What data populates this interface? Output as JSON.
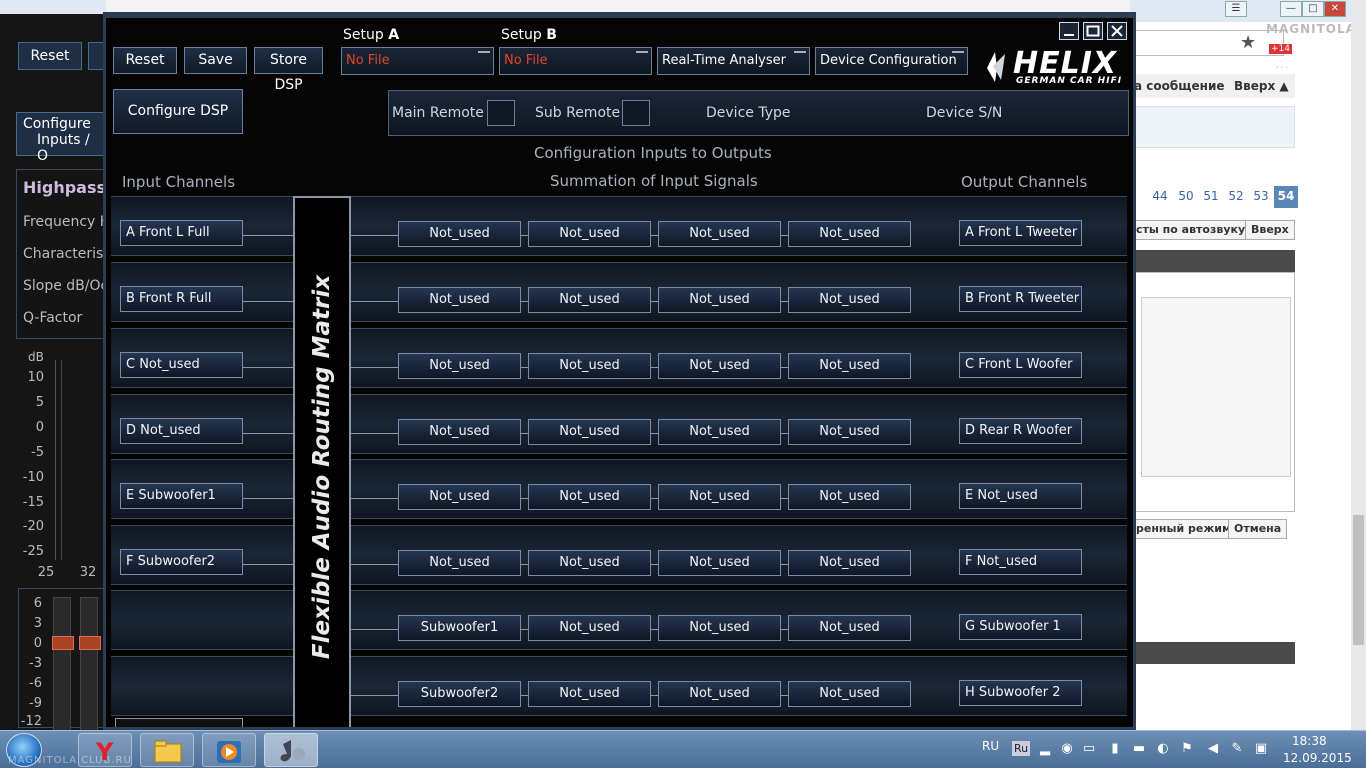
{
  "browser": {
    "pin_buttons": [
      "☰",
      "—",
      "□",
      "✕"
    ],
    "logo": "MAGNITOLA",
    "badge": "+14",
    "faded_heading": "…",
    "bar_left": "а сообщение",
    "bar_right": "Вверх ▲",
    "pages": [
      "44",
      "50",
      "51",
      "52",
      "53",
      "54"
    ],
    "btn_sound": "сты по автозвуку",
    "btn_up": "Вверх",
    "btn_mode": "ренный режим",
    "btn_cancel": "Отмена"
  },
  "left_app": {
    "reset": "Reset",
    "configure_line1": "Configure",
    "configure_line2": "Inputs / O",
    "highpass_title": "Highpass",
    "params": [
      "Frequency H",
      "Characteristi",
      "Slope dB/Oct",
      "Q-Factor"
    ],
    "db": "dB",
    "db_ticks": [
      "10",
      "5",
      "0",
      "-5",
      "-10",
      "-15",
      "-20",
      "-25"
    ],
    "x_ticks": [
      "25",
      "32"
    ],
    "fader_ticks": [
      "6",
      "3",
      "0",
      "-3",
      "-6",
      "-9",
      "-12"
    ]
  },
  "toolbar": {
    "reset": "Reset",
    "save": "Save",
    "store_dsp": "Store DSP",
    "setup_a_prefix": "Setup ",
    "setup_a_letter": "A",
    "setup_b_prefix": "Setup ",
    "setup_b_letter": "B",
    "setup_a_file": "No File",
    "setup_b_file": "No File",
    "rta": "Real-Time Analyser",
    "device_config": "Device Configuration",
    "configure_dsp": "Configure DSP"
  },
  "logo": {
    "brand": "HELIX",
    "sub": "GERMAN CAR HIFI"
  },
  "remote": {
    "main": "Main Remote",
    "sub": "Sub Remote",
    "device_type": "Device Type",
    "device_sn": "Device S/N"
  },
  "headings": {
    "title": "Configuration Inputs to Outputs",
    "inputs": "Input Channels",
    "summation": "Summation of Input Signals",
    "outputs": "Output Channels",
    "vertical": "Flexible Audio Routing Matrix"
  },
  "rows": [
    {
      "input": "A   Front L Full",
      "sums": [
        "Not_used",
        "Not_used",
        "Not_used",
        "Not_used"
      ],
      "output": "A   Front L Tweeter"
    },
    {
      "input": "B   Front R Full",
      "sums": [
        "Not_used",
        "Not_used",
        "Not_used",
        "Not_used"
      ],
      "output": "B   Front R Tweeter"
    },
    {
      "input": "C     Not_used",
      "sums": [
        "Not_used",
        "Not_used",
        "Not_used",
        "Not_used"
      ],
      "output": "C   Front L Woofer"
    },
    {
      "input": "D     Not_used",
      "sums": [
        "Not_used",
        "Not_used",
        "Not_used",
        "Not_used"
      ],
      "output": "D   Rear R Woofer"
    },
    {
      "input": "E    Subwoofer1",
      "sums": [
        "Not_used",
        "Not_used",
        "Not_used",
        "Not_used"
      ],
      "output": "E      Not_used"
    },
    {
      "input": "F    Subwoofer2",
      "sums": [
        "Not_used",
        "Not_used",
        "Not_used",
        "Not_used"
      ],
      "output": "F      Not_used"
    },
    {
      "input": null,
      "sums": [
        "Subwoofer1",
        "Not_used",
        "Not_used",
        "Not_used"
      ],
      "output": "G   Subwoofer 1"
    },
    {
      "input": null,
      "sums": [
        "Subwoofer2",
        "Not_used",
        "Not_used",
        "Not_used"
      ],
      "output": "H   Subwoofer 2"
    }
  ],
  "taskbar": {
    "lang": "RU",
    "ru": "Ru",
    "time": "18:38",
    "date": "12.09.2015",
    "watermark": "MAGNITOLA.CLUB.RU"
  }
}
